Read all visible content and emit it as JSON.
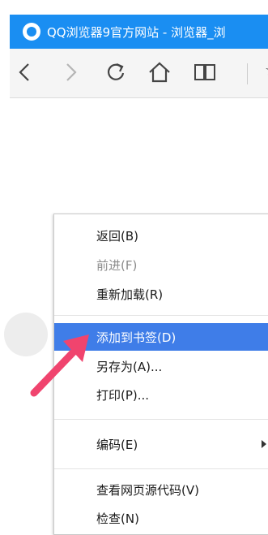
{
  "window": {
    "title": "QQ浏览器9官方网站 - 浏览器_浏"
  },
  "toolbar": {
    "back_icon": "chevron-left-icon",
    "forward_icon": "chevron-right-icon",
    "refresh_icon": "refresh-icon",
    "home_icon": "home-icon",
    "reader_icon": "book-icon",
    "star_icon": "star-icon"
  },
  "context_menu": {
    "items": [
      {
        "label": "返回(B)",
        "state": "enabled"
      },
      {
        "label": "前进(F)",
        "state": "disabled"
      },
      {
        "label": "重新加载(R)",
        "state": "enabled"
      },
      {
        "label": "添加到书签(D)",
        "state": "highlighted"
      },
      {
        "label": "另存为(A)...",
        "state": "enabled"
      },
      {
        "label": "打印(P)...",
        "state": "enabled"
      },
      {
        "label": "编码(E)",
        "state": "enabled",
        "submenu": true
      },
      {
        "label": "查看网页源代码(V)",
        "state": "enabled"
      },
      {
        "label": "检查(N)",
        "state": "enabled"
      }
    ]
  },
  "colors": {
    "titlebar": "#1a8ef2",
    "highlight": "#3f7de8",
    "pointer": "#f0446e"
  }
}
